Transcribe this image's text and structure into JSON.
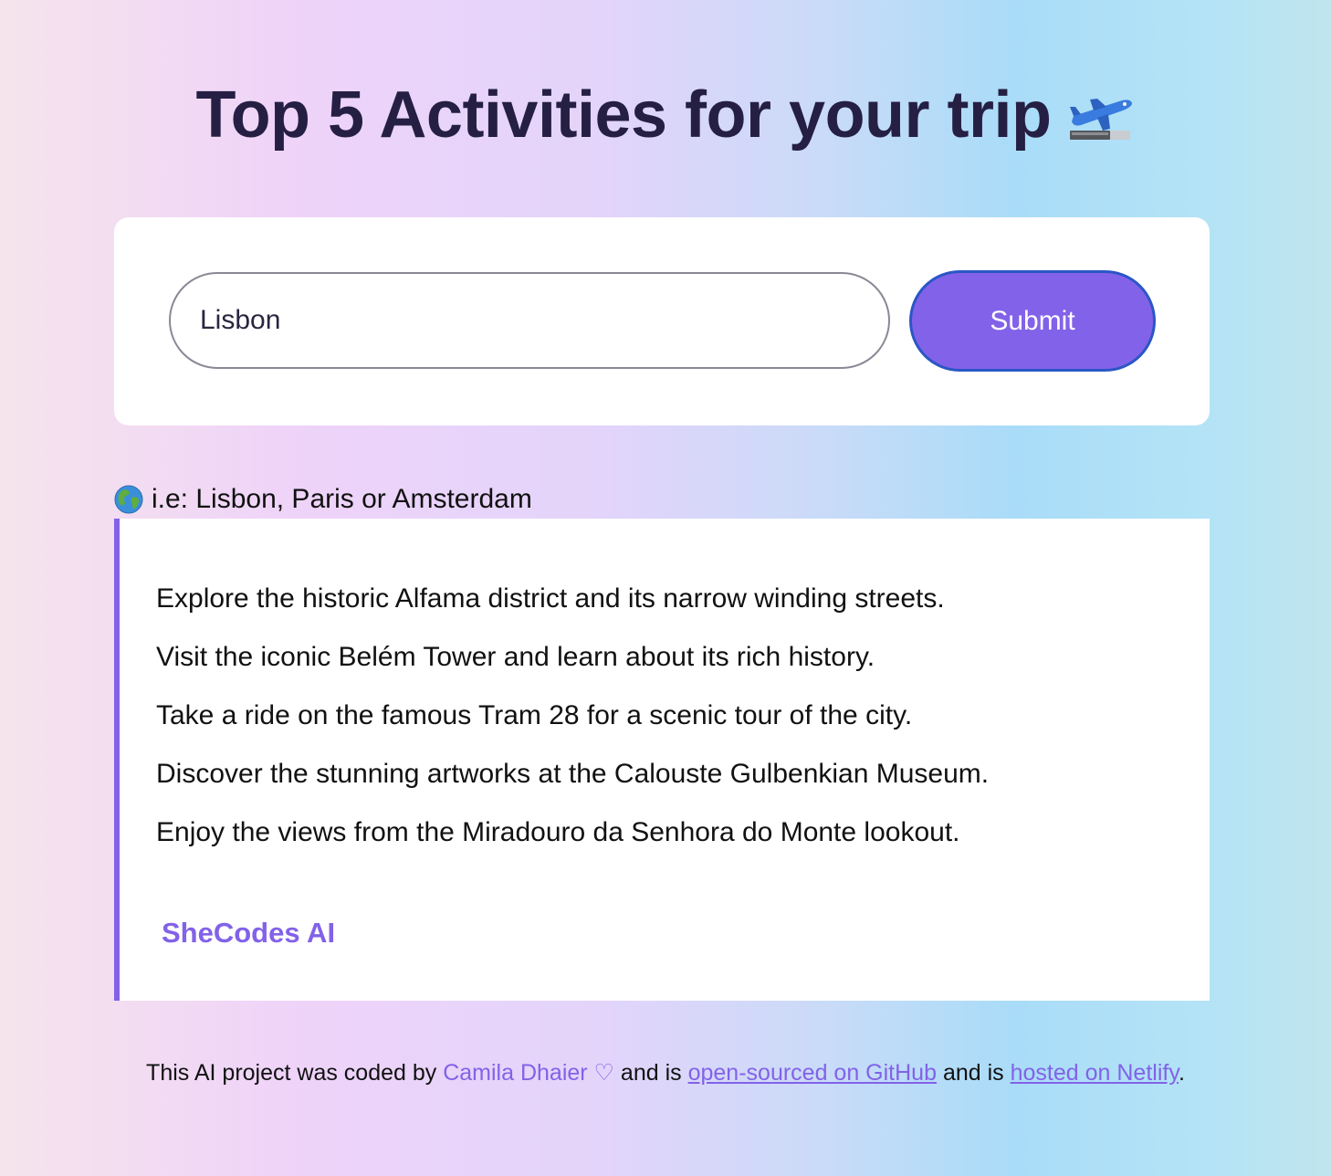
{
  "header": {
    "title": "Top 5 Activities for your trip"
  },
  "search": {
    "value": "Lisbon",
    "submit_label": "Submit"
  },
  "hint": {
    "text": "i.e: Lisbon, Paris or Amsterdam"
  },
  "results": {
    "items": [
      "Explore the historic Alfama district and its narrow winding streets.",
      "Visit the iconic Belém Tower and learn about its rich history.",
      "Take a ride on the famous Tram 28 for a scenic tour of the city.",
      "Discover the stunning artworks at the Calouste Gulbenkian Museum.",
      "Enjoy the views from the Miradouro da Senhora do Monte lookout."
    ],
    "signature": "SheCodes AI"
  },
  "footer": {
    "prefix": "This AI project was coded by",
    "author": "Camila Dhaier ♡",
    "middle1": "and is",
    "github_link": "open-sourced on GitHub",
    "middle2": "and is",
    "netlify_link": "hosted on Netlify",
    "suffix": "."
  },
  "colors": {
    "accent": "#8262e8",
    "title": "#251f43",
    "button_border": "#2a56c6"
  },
  "icons": {
    "title_icon": "airplane-departure-icon",
    "hint_icon": "globe-icon"
  }
}
